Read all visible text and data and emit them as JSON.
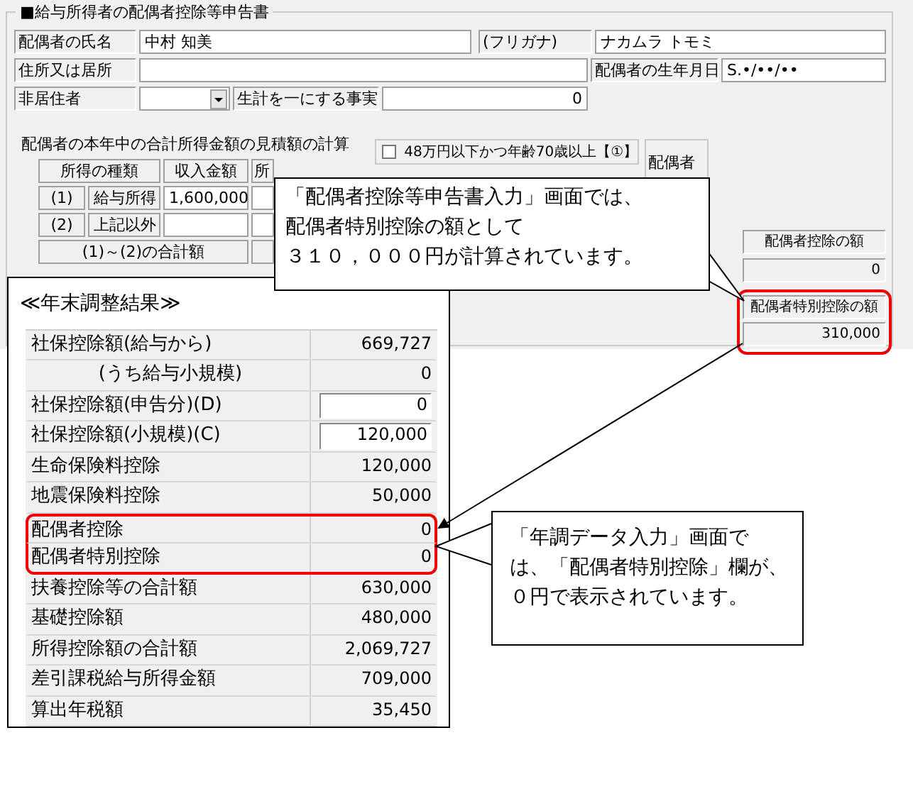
{
  "declaration": {
    "title": "■給与所得者の配偶者控除等申告書",
    "spouse_name_label": "配偶者の氏名",
    "spouse_name": "中村 知美",
    "furigana_label": "(フリガナ)",
    "furigana": "ナカムラ トモミ",
    "address_label": "住所又は居所",
    "birthdate_label": "配偶者の生年月日",
    "birthdate": "S.•/••/••",
    "nonresident_label": "非居住者",
    "livelihood_label": "生計を一にする事実",
    "livelihood_value": "0",
    "income_title": "配偶者の本年中の合計所得金額の見積額の計算",
    "income_columns": [
      "所得の種類",
      "収入金額",
      "所"
    ],
    "income_rows": [
      {
        "no": "(1)",
        "type": "給与所得",
        "revenue": "1,600,000"
      },
      {
        "no": "(2)",
        "type": "上記以外"
      }
    ],
    "income_total_label": "(1)～(2)の合計額",
    "elderly_check": {
      "label": "48万円以下かつ年齢70歳以上【①】",
      "checked": false
    },
    "spouse_header": "配偶者",
    "deduction_label": "配偶者控除の額",
    "deduction": "0",
    "special_label": "配偶者特別控除の額",
    "special": "310,000",
    "special_highlighted": true
  },
  "year_end": {
    "title": "≪年末調整結果≫",
    "rows": [
      {
        "label": "社保控除額(給与から)",
        "value": "669,727",
        "kind": "plain",
        "highlighted": false
      },
      {
        "label": "(うち給与小規模)",
        "value": "0",
        "kind": "sub",
        "highlighted": false
      },
      {
        "label": "社保控除額(申告分)(D)",
        "value": "0",
        "kind": "input",
        "highlighted": false
      },
      {
        "label": "社保控除額(小規模)(C)",
        "value": "120,000",
        "kind": "input",
        "highlighted": false
      },
      {
        "label": "生命保険料控除",
        "value": "120,000",
        "kind": "plain",
        "highlighted": false
      },
      {
        "label": "地震保険料控除",
        "value": "50,000",
        "kind": "plain",
        "highlighted": false
      },
      {
        "label": "配偶者控除",
        "value": "0",
        "kind": "plain",
        "highlighted": true
      },
      {
        "label": "配偶者特別控除",
        "value": "0",
        "kind": "plain",
        "highlighted": true
      },
      {
        "label": "扶養控除等の合計額",
        "value": "630,000",
        "kind": "plain",
        "highlighted": false
      },
      {
        "label": "基礎控除額",
        "value": "480,000",
        "kind": "plain",
        "highlighted": false
      },
      {
        "label": "所得控除額の合計額",
        "value": "2,069,727",
        "kind": "plain",
        "highlighted": false
      },
      {
        "label": "差引課税給与所得金額",
        "value": "709,000",
        "kind": "plain",
        "highlighted": false
      },
      {
        "label": "算出年税額",
        "value": "35,450",
        "kind": "plain",
        "highlighted": false
      }
    ]
  },
  "callouts": [
    {
      "lines": [
        "「配偶者控除等申告書入力」画面では、",
        "配偶者特別控除の額として",
        "３１０，０００円が計算されています。"
      ]
    },
    {
      "lines": [
        "「年調データ入力」画面で",
        "は、「配偶者特別控除」欄が、",
        "０円で表示されています。"
      ]
    }
  ]
}
